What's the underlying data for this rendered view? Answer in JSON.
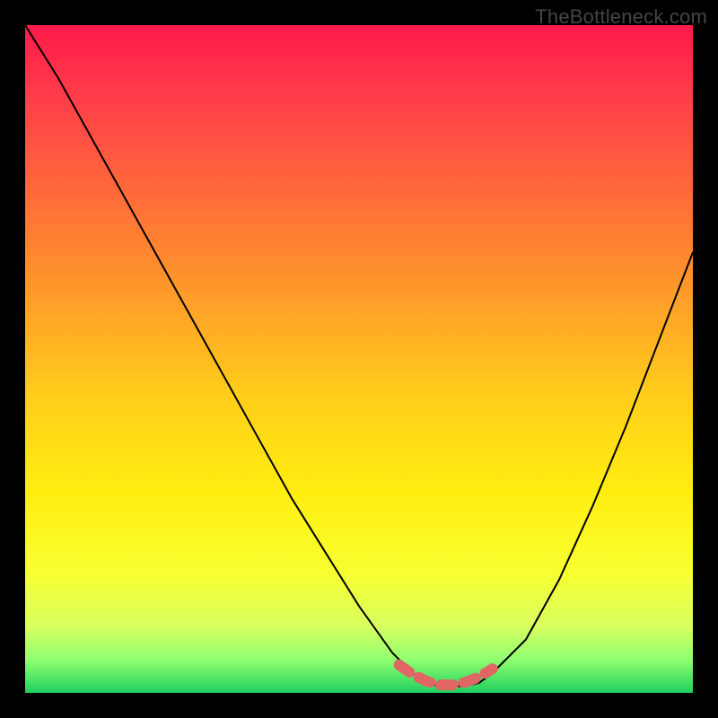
{
  "watermark": "TheBottleneck.com",
  "chart_data": {
    "type": "line",
    "title": "",
    "xlabel": "",
    "ylabel": "",
    "xlim": [
      0,
      100
    ],
    "ylim": [
      0,
      100
    ],
    "series": [
      {
        "name": "bottleneck-curve",
        "x": [
          0,
          5,
          10,
          15,
          20,
          25,
          30,
          35,
          40,
          45,
          50,
          55,
          58,
          60,
          62,
          64,
          66,
          68,
          70,
          75,
          80,
          85,
          90,
          95,
          100
        ],
        "y": [
          100,
          92,
          83,
          74,
          65,
          56,
          47,
          38,
          29,
          21,
          13,
          6,
          3,
          1.5,
          1,
          1,
          1,
          1.5,
          3,
          8,
          17,
          28,
          40,
          53,
          66
        ],
        "color": "#000000"
      }
    ],
    "highlight": {
      "name": "optimal-region",
      "x": [
        56,
        58,
        60,
        62,
        64,
        66,
        68,
        70
      ],
      "y": [
        4.2,
        2.8,
        1.8,
        1.2,
        1.2,
        1.6,
        2.4,
        3.6
      ],
      "color": "#e06666",
      "style": "dashed-thick"
    },
    "background_gradient": {
      "stops": [
        {
          "offset": 0.0,
          "color": "#ff1a4a"
        },
        {
          "offset": 0.1,
          "color": "#ff3a4a"
        },
        {
          "offset": 0.25,
          "color": "#ff6a3a"
        },
        {
          "offset": 0.4,
          "color": "#ff9a2a"
        },
        {
          "offset": 0.55,
          "color": "#ffcc1a"
        },
        {
          "offset": 0.7,
          "color": "#ffee10"
        },
        {
          "offset": 0.82,
          "color": "#f8ff30"
        },
        {
          "offset": 0.9,
          "color": "#d8ff60"
        },
        {
          "offset": 0.95,
          "color": "#90ff70"
        },
        {
          "offset": 1.0,
          "color": "#20d060"
        }
      ]
    }
  }
}
